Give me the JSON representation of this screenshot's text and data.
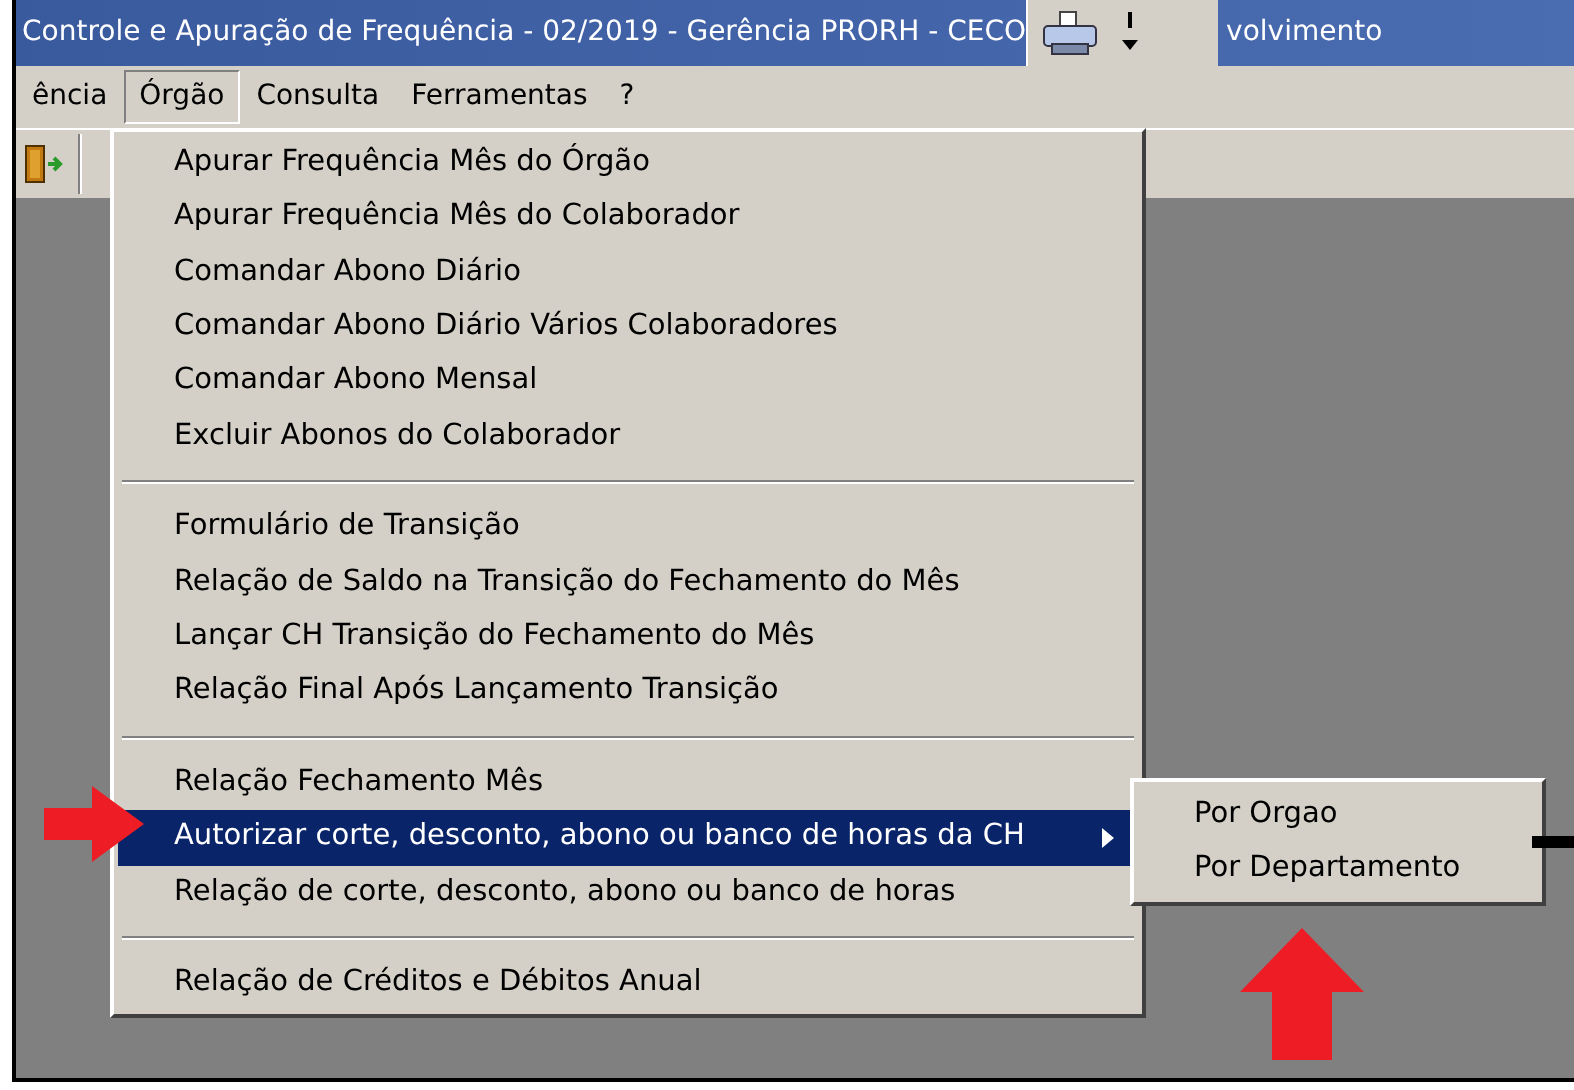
{
  "window": {
    "title": "Controle e Apuração de Frequência - 02/2019 - Gerência PRORH - CECO",
    "title_tail": "volvimento"
  },
  "menubar": [
    {
      "label": "ência",
      "selected": false
    },
    {
      "label": "Órgão",
      "selected": true
    },
    {
      "label": "Consulta",
      "selected": false
    },
    {
      "label": "Ferramentas",
      "selected": false
    },
    {
      "label": "?",
      "selected": false
    }
  ],
  "menu": {
    "groups": [
      {
        "items": [
          {
            "label": "Apurar Frequência Mês do Órgão",
            "selected": false,
            "submenu": false
          },
          {
            "label": "Apurar Frequência Mês do Colaborador",
            "selected": false,
            "submenu": false
          },
          {
            "label": "Comandar Abono Diário",
            "selected": false,
            "submenu": false
          },
          {
            "label": "Comandar Abono Diário Vários Colaboradores",
            "selected": false,
            "submenu": false
          },
          {
            "label": "Comandar Abono Mensal",
            "selected": false,
            "submenu": false
          },
          {
            "label": "Excluir Abonos do Colaborador",
            "selected": false,
            "submenu": false
          }
        ]
      },
      {
        "items": [
          {
            "label": "Formulário de Transição",
            "selected": false,
            "submenu": false
          },
          {
            "label": "Relação de Saldo na Transição do Fechamento do Mês",
            "selected": false,
            "submenu": false
          },
          {
            "label": "Lançar CH Transição do Fechamento do Mês",
            "selected": false,
            "submenu": false
          },
          {
            "label": "Relação Final Após Lançamento Transição",
            "selected": false,
            "submenu": false
          }
        ]
      },
      {
        "items": [
          {
            "label": "Relação Fechamento Mês",
            "selected": false,
            "submenu": false
          },
          {
            "label": "Autorizar corte, desconto, abono ou banco de horas da CH",
            "selected": true,
            "submenu": true
          },
          {
            "label": "Relação de corte, desconto, abono ou banco de horas",
            "selected": false,
            "submenu": false
          }
        ]
      },
      {
        "items": [
          {
            "label": "Relação de Créditos e Débitos Anual",
            "selected": false,
            "submenu": false
          }
        ]
      }
    ]
  },
  "submenu": {
    "items": [
      {
        "label": "Por Orgao",
        "selected": false
      },
      {
        "label": "Por Departamento",
        "selected": false
      }
    ]
  }
}
